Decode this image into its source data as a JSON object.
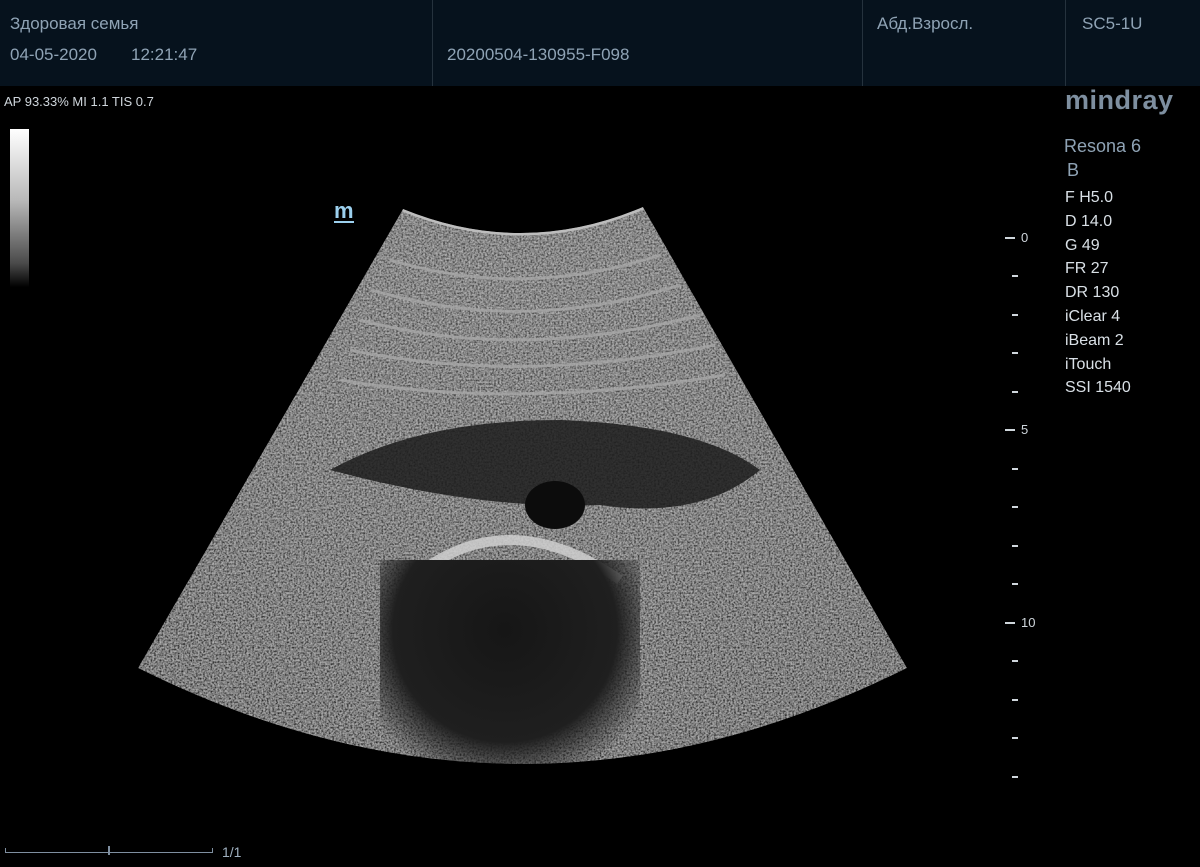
{
  "header": {
    "facility": "Здоровая семья",
    "date": "04-05-2020",
    "time": "12:21:47",
    "exam_id": "20200504-130955-F098",
    "preset": "Абд.Взросл.",
    "probe": "SC5-1U"
  },
  "acoustic": "AP 93.33%  MI 1.1 TIS 0.7",
  "brand": "mindray",
  "system": {
    "model": "Resona 6",
    "mode": "B",
    "params": [
      "F H5.0",
      "D 14.0",
      "G 49",
      "FR 27",
      "DR 130",
      "iClear 4",
      "iBeam 2",
      "iTouch",
      "SSI 1540"
    ]
  },
  "orientation_mark": "m",
  "depth_scale": {
    "labels": [
      "0",
      "5",
      "10"
    ]
  },
  "footer": {
    "page": "1/1"
  }
}
